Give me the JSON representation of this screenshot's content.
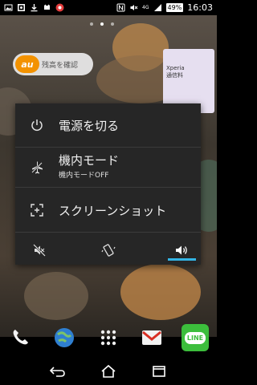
{
  "status_bar": {
    "time": "16:03",
    "battery": "49%",
    "network": "4G",
    "left_icons": [
      "photo-icon",
      "image-icon",
      "download-icon",
      "kitty-icon",
      "app-notification-icon"
    ],
    "right_icons": [
      "nfc-icon",
      "mute-icon",
      "signal-icon",
      "battery-icon"
    ]
  },
  "home": {
    "au_widget": {
      "logo_text": "au",
      "label": "残高を確認"
    },
    "xperia_widget": {
      "line1": "Xperia",
      "line2": "通信料"
    }
  },
  "power_menu": {
    "items": [
      {
        "label": "電源を切る",
        "icon": "power-icon"
      },
      {
        "label": "機内モード",
        "sublabel": "機内モードOFF",
        "icon": "airplane-icon"
      },
      {
        "label": "スクリーンショット",
        "icon": "screenshot-icon"
      }
    ],
    "sound_modes": [
      {
        "name": "silent",
        "icon": "silent-mode-icon",
        "selected": false
      },
      {
        "name": "vibrate",
        "icon": "vibrate-mode-icon",
        "selected": false
      },
      {
        "name": "sound",
        "icon": "sound-mode-icon",
        "selected": true
      }
    ],
    "accent_color": "#33b5e5"
  },
  "dock": {
    "icons": [
      "phone-icon",
      "browser-icon",
      "app-drawer-icon",
      "gmail-icon",
      "line-icon"
    ],
    "line_label": "LINE"
  },
  "nav_bar": {
    "buttons": [
      "back-icon",
      "home-icon",
      "recents-icon"
    ]
  }
}
